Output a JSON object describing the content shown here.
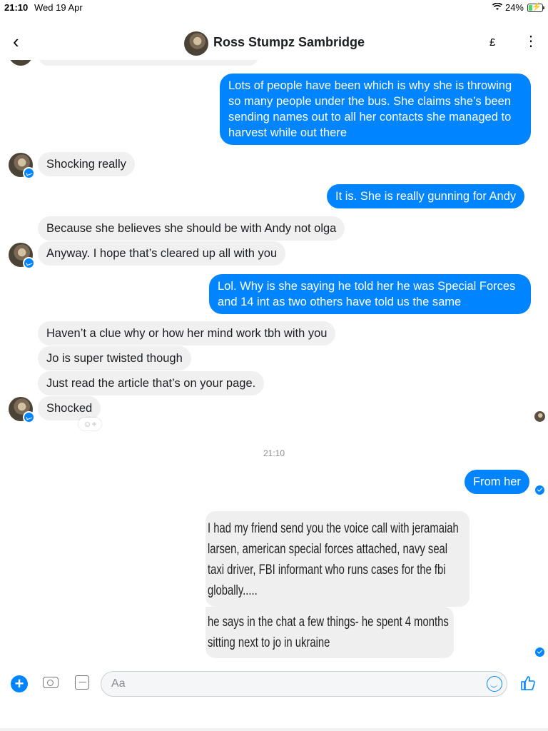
{
  "status": {
    "time": "21:10",
    "date": "Wed 19 Apr",
    "battery": "24%"
  },
  "header": {
    "name": "Ross Stumpz Sambridge",
    "currency": "£",
    "more": "⋮",
    "back": "‹"
  },
  "messages": {
    "out1": "Lots of people have been which is why she is throwing so many people under the bus. She claims she’s been sending names out to all her contacts she managed to harvest while out there",
    "in1": "Shocking really",
    "out2": "It is. She is really gunning for Andy",
    "in2a": "Because she believes she should be with Andy not olga",
    "in2b": "Anyway. I hope that’s cleared up all with you",
    "out3": "Lol. Why is she saying he told her he was Special Forces and 14 int as two others have told us the same",
    "in3a": "Haven’t a clue why or how her mind work tbh with you",
    "in3b": "Jo is super twisted though",
    "in3c": "Just read the article that’s on your page.",
    "in3d": "Shocked",
    "out4": "From her"
  },
  "timestamp": "21:10",
  "photo_text": {
    "line1": "I had my friend send you the voice call with jeramaiah larsen, american special forces attached, navy seal taxi driver, FBI informant who runs cases for the fbi globally.....",
    "line2": "he says in the chat a few things- he spent 4 months sitting next to jo in ukraine"
  },
  "composer": {
    "placeholder": "Aa"
  },
  "icons": [
    "chevron-left-icon",
    "currency-icon",
    "more-icon",
    "plus-icon",
    "camera-icon",
    "image-icon",
    "emoji-icon",
    "like-icon",
    "wifi-icon",
    "battery-icon"
  ]
}
